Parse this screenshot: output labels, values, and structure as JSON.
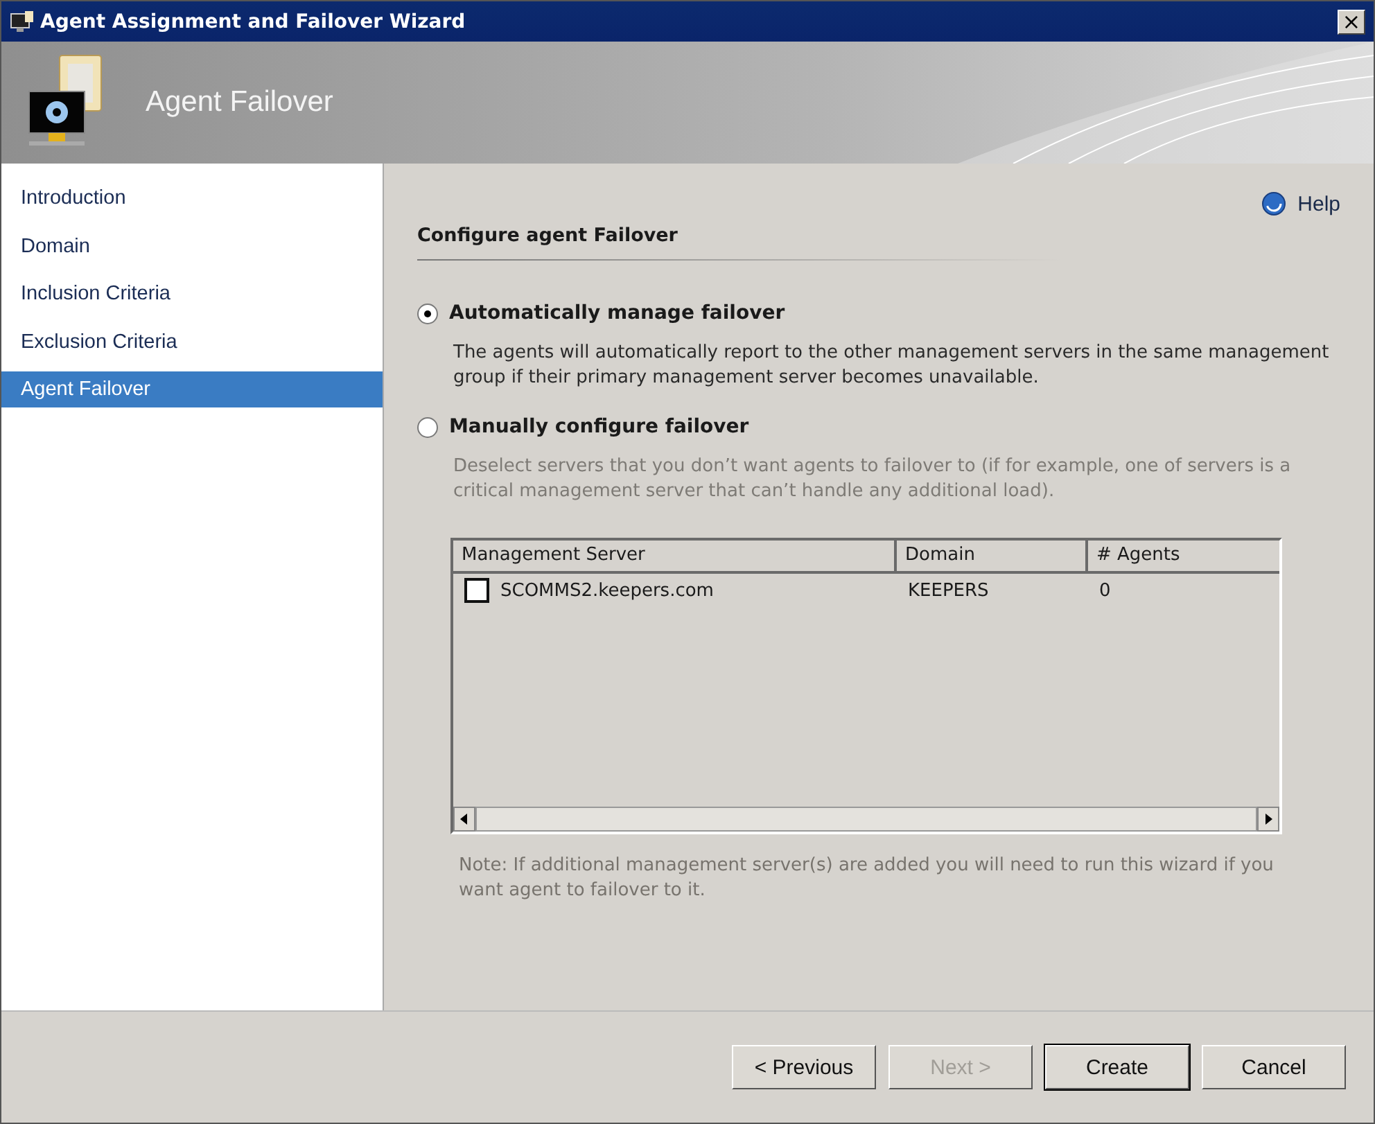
{
  "window": {
    "title": "Agent Assignment and Failover Wizard",
    "close": "×"
  },
  "header": {
    "title": "Agent Failover"
  },
  "sidebar": {
    "items": [
      {
        "label": "Introduction",
        "selected": false
      },
      {
        "label": "Domain",
        "selected": false
      },
      {
        "label": "Inclusion Criteria",
        "selected": false
      },
      {
        "label": "Exclusion Criteria",
        "selected": false
      },
      {
        "label": "Agent Failover",
        "selected": true
      }
    ]
  },
  "help": "Help",
  "section_title": "Configure agent Failover",
  "options": [
    {
      "label": "Automatically manage failover",
      "selected": true,
      "description": "The agents will automatically report to the other management servers in the same management group if their primary management server becomes unavailable."
    },
    {
      "label": "Manually configure failover",
      "selected": false,
      "description": "Deselect servers that you don’t want agents to failover to (if for example, one of servers is a critical management server that can’t handle any additional load)."
    }
  ],
  "table": {
    "columns": [
      "Management Server",
      "Domain",
      "# Agents"
    ],
    "rows": [
      {
        "checked": false,
        "cells": [
          "SCOMMS2.keepers.com",
          "KEEPERS",
          "0"
        ]
      }
    ]
  },
  "note": "Note: If additional management server(s) are added you will need to run this wizard if you want agent to failover to it.",
  "buttons": [
    {
      "label": "< Previous",
      "disabled": false,
      "default": false
    },
    {
      "label": "Next >",
      "disabled": true,
      "default": false
    },
    {
      "label": "Create",
      "disabled": false,
      "default": true
    },
    {
      "label": "Cancel",
      "disabled": false,
      "default": false
    }
  ]
}
